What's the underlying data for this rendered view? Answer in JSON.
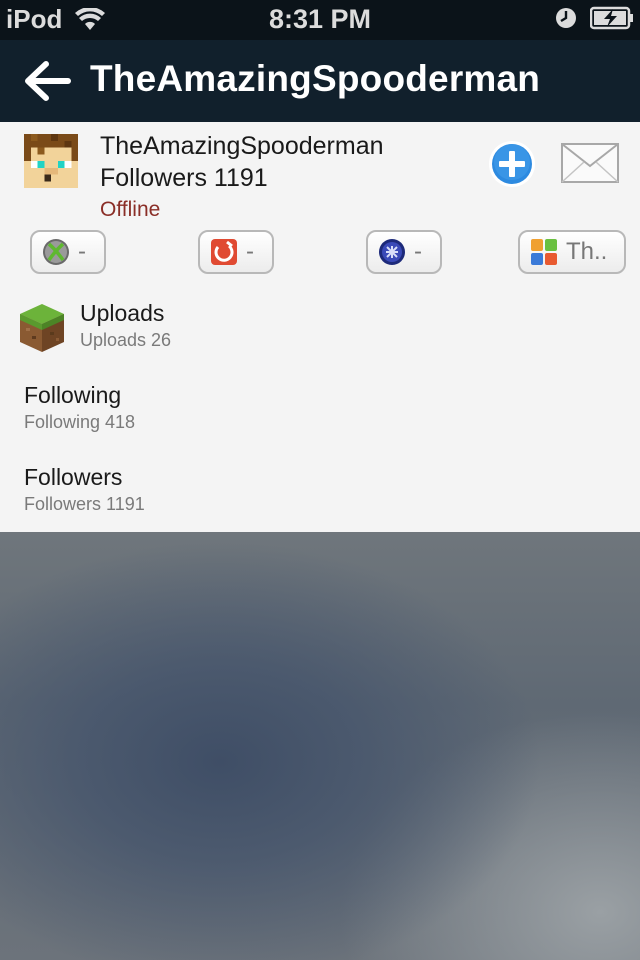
{
  "status_bar": {
    "carrier": "iPod",
    "time": "8:31 PM",
    "icons": [
      "wifi-icon",
      "clock-icon",
      "battery-charging-icon"
    ]
  },
  "nav": {
    "back_icon": "arrow-left-icon",
    "title": "TheAmazingSpooderman"
  },
  "profile": {
    "name": "TheAmazingSpooderman",
    "followers": "Followers 1191",
    "status": "Offline",
    "status_color": "#8a2e27",
    "follow_icon": "plus-circle-icon",
    "follow_color": "#2d8ae0",
    "message_icon": "envelope-icon"
  },
  "platforms": [
    {
      "icon": "xbox-icon",
      "value": "-"
    },
    {
      "icon": "origin-icon",
      "value": "-"
    },
    {
      "icon": "playstation-network-icon",
      "value": "-"
    },
    {
      "icon": "game-center-icon",
      "value": "Th.."
    }
  ],
  "list": {
    "uploads": {
      "title": "Uploads",
      "sub": "Uploads 26",
      "icon": "grass-block-icon"
    },
    "following": {
      "title": "Following",
      "sub": "Following 418"
    },
    "followers": {
      "title": "Followers",
      "sub": "Followers 1191"
    }
  }
}
